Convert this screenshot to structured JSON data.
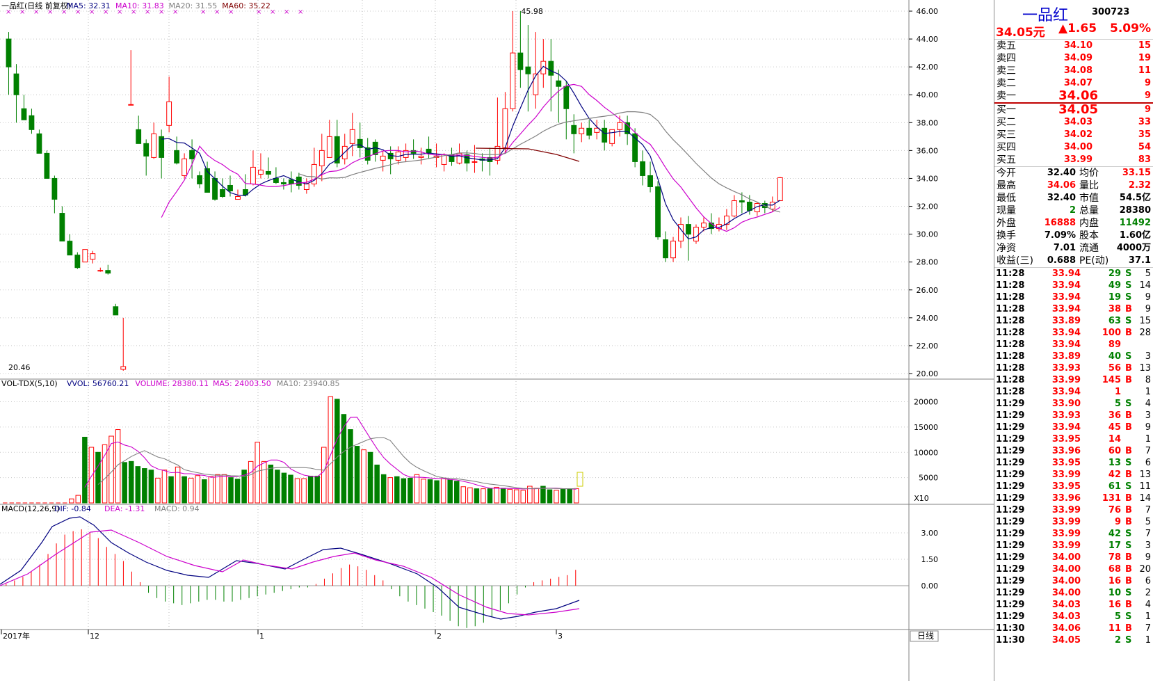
{
  "stock": {
    "name": "一品红",
    "code": "300723",
    "price": "34.05元",
    "change": "▲1.65",
    "change_pct": "5.09%"
  },
  "orderbook": {
    "asks": [
      {
        "label": "卖五",
        "price": "34.10",
        "vol": "15"
      },
      {
        "label": "卖四",
        "price": "34.09",
        "vol": "19"
      },
      {
        "label": "卖三",
        "price": "34.08",
        "vol": "11"
      },
      {
        "label": "卖二",
        "price": "34.07",
        "vol": "9"
      },
      {
        "label": "卖一",
        "price": "34.06",
        "vol": "9"
      }
    ],
    "bids": [
      {
        "label": "买一",
        "price": "34.05",
        "vol": "9"
      },
      {
        "label": "买二",
        "price": "34.03",
        "vol": "33"
      },
      {
        "label": "买三",
        "price": "34.02",
        "vol": "35"
      },
      {
        "label": "买四",
        "price": "34.00",
        "vol": "54"
      },
      {
        "label": "买五",
        "price": "33.99",
        "vol": "83"
      }
    ]
  },
  "stats": [
    {
      "k1": "今开",
      "v1": "32.40",
      "c1": "blk",
      "k2": "均价",
      "v2": "33.15",
      "c2": "red"
    },
    {
      "k1": "最高",
      "v1": "34.06",
      "c1": "red",
      "k2": "量比",
      "v2": "2.32",
      "c2": "red"
    },
    {
      "k1": "最低",
      "v1": "32.40",
      "c1": "blk",
      "k2": "市值",
      "v2": "54.5亿",
      "c2": "blk"
    },
    {
      "k1": "现量",
      "v1": "2",
      "c1": "grn",
      "k2": "总量",
      "v2": "28380",
      "c2": "blk"
    },
    {
      "k1": "外盘",
      "v1": "16888",
      "c1": "red",
      "k2": "内盘",
      "v2": "11492",
      "c2": "grn"
    },
    {
      "k1": "换手",
      "v1": "7.09%",
      "c1": "blk",
      "k2": "股本",
      "v2": "1.60亿",
      "c2": "blk"
    },
    {
      "k1": "净资",
      "v1": "7.01",
      "c1": "blk",
      "k2": "流通",
      "v2": "4000万",
      "c2": "blk"
    },
    {
      "k1": "收益(三)",
      "v1": "0.688",
      "c1": "blk",
      "k2": "PE(动)",
      "v2": "37.1",
      "c2": "blk"
    }
  ],
  "ticks": [
    [
      "11:28",
      "33.94",
      "29",
      "S",
      "5"
    ],
    [
      "11:28",
      "33.94",
      "49",
      "S",
      "14"
    ],
    [
      "11:28",
      "33.94",
      "19",
      "S",
      "9"
    ],
    [
      "11:28",
      "33.94",
      "38",
      "B",
      "9"
    ],
    [
      "11:28",
      "33.89",
      "63",
      "S",
      "15"
    ],
    [
      "11:28",
      "33.94",
      "100",
      "B",
      "28"
    ],
    [
      "11:28",
      "33.94",
      "89",
      "",
      ""
    ],
    [
      "11:28",
      "33.89",
      "40",
      "S",
      "3"
    ],
    [
      "11:28",
      "33.93",
      "56",
      "B",
      "13"
    ],
    [
      "11:28",
      "33.99",
      "145",
      "B",
      "8"
    ],
    [
      "11:28",
      "33.94",
      "1",
      "",
      "1"
    ],
    [
      "11:29",
      "33.90",
      "5",
      "S",
      "4"
    ],
    [
      "11:29",
      "33.93",
      "36",
      "B",
      "3"
    ],
    [
      "11:29",
      "33.94",
      "45",
      "B",
      "9"
    ],
    [
      "11:29",
      "33.95",
      "14",
      "",
      "1"
    ],
    [
      "11:29",
      "33.96",
      "60",
      "B",
      "7"
    ],
    [
      "11:29",
      "33.95",
      "13",
      "S",
      "6"
    ],
    [
      "11:29",
      "33.99",
      "42",
      "B",
      "13"
    ],
    [
      "11:29",
      "33.95",
      "61",
      "S",
      "11"
    ],
    [
      "11:29",
      "33.96",
      "131",
      "B",
      "14"
    ],
    [
      "11:29",
      "33.99",
      "76",
      "B",
      "7"
    ],
    [
      "11:29",
      "33.99",
      "9",
      "B",
      "5"
    ],
    [
      "11:29",
      "33.99",
      "42",
      "S",
      "7"
    ],
    [
      "11:29",
      "33.99",
      "17",
      "S",
      "3"
    ],
    [
      "11:29",
      "34.00",
      "78",
      "B",
      "9"
    ],
    [
      "11:29",
      "34.00",
      "68",
      "B",
      "20"
    ],
    [
      "11:29",
      "34.00",
      "16",
      "B",
      "6"
    ],
    [
      "11:29",
      "34.00",
      "10",
      "S",
      "2"
    ],
    [
      "11:29",
      "34.03",
      "16",
      "B",
      "4"
    ],
    [
      "11:29",
      "34.03",
      "5",
      "S",
      "1"
    ],
    [
      "11:30",
      "34.06",
      "11",
      "B",
      "7"
    ],
    [
      "11:30",
      "34.05",
      "2",
      "S",
      "1"
    ]
  ],
  "kline": {
    "title": "一品红(日线 前复权)",
    "ma_labels": [
      {
        "text": "MA5: 32.31",
        "color": "#000080"
      },
      {
        "text": "MA10: 31.83",
        "color": "#cc00cc"
      },
      {
        "text": "MA20: 31.55",
        "color": "#808080"
      },
      {
        "text": "MA60: 35.22",
        "color": "#800000"
      }
    ],
    "high_label": "45.98",
    "low_label": "20.46",
    "y_ticks": [
      "46.00",
      "44.00",
      "42.00",
      "40.00",
      "38.00",
      "36.00",
      "34.00",
      "32.00",
      "30.00",
      "28.00",
      "26.00",
      "24.00",
      "22.00",
      "20.00"
    ],
    "candles": [
      [
        44,
        44.5,
        42,
        40
      ],
      [
        41.5,
        42.2,
        40,
        38
      ],
      [
        39,
        40,
        38.2,
        38.5
      ],
      [
        38.5,
        39,
        37.5,
        37.2
      ],
      [
        37.2,
        37.5,
        35.8,
        36
      ],
      [
        35.8,
        36,
        34,
        34
      ],
      [
        34,
        34.2,
        32.5,
        31.5
      ],
      [
        31.5,
        32,
        29.5,
        29.5
      ],
      [
        29.5,
        30,
        28.5,
        28.5
      ],
      [
        28.5,
        28.7,
        27.6,
        27.5
      ],
      [
        28,
        28.4,
        28.9,
        28
      ],
      [
        28.2,
        28.8,
        28.6,
        27.9
      ],
      [
        27.4,
        27.6,
        27.4,
        27.3
      ],
      [
        27.4,
        27.8,
        27.2,
        27.1
      ],
      [
        24.8,
        25,
        24.2,
        24.2
      ],
      [
        20.3,
        24,
        20.5,
        20.2
      ],
      [
        39.3,
        43.2,
        39.3,
        39.3
      ],
      [
        37.5,
        38.5,
        36.5,
        36.5
      ],
      [
        36.5,
        36.8,
        35.6,
        34.2
      ],
      [
        35.5,
        38,
        37.2,
        35.4
      ],
      [
        37,
        37.5,
        35.5,
        34
      ],
      [
        37.8,
        41.3,
        39.5,
        37.3
      ],
      [
        36,
        37,
        35.1,
        35
      ],
      [
        34.2,
        35.8,
        35.4,
        34
      ],
      [
        36,
        36.8,
        35.4,
        34
      ],
      [
        34.2,
        34.5,
        33.6,
        33.3
      ],
      [
        34.7,
        35.2,
        33,
        33
      ],
      [
        34,
        34.5,
        32.5,
        32.4
      ],
      [
        33.2,
        34,
        32.7,
        32.6
      ],
      [
        33.5,
        34.2,
        33.1,
        32.7
      ],
      [
        32.5,
        33.2,
        32.7,
        32.5
      ],
      [
        33.2,
        34.3,
        32.8,
        32.7
      ],
      [
        33.6,
        36,
        34.8,
        33.5
      ],
      [
        34.3,
        35.8,
        34.6,
        34
      ],
      [
        34.5,
        35.5,
        34.3,
        34
      ],
      [
        34,
        34.8,
        33.7,
        33.6
      ],
      [
        33.7,
        34,
        33.6,
        33.2
      ],
      [
        33.9,
        34.5,
        33.6,
        33
      ],
      [
        34.1,
        34.4,
        33.5,
        33.2
      ],
      [
        33.2,
        34,
        33.6,
        32.9
      ],
      [
        33.6,
        36.2,
        35,
        33.4
      ],
      [
        34.9,
        37.2,
        36,
        33.8
      ],
      [
        35.5,
        38.2,
        37,
        35.5
      ],
      [
        37,
        38.2,
        35.1,
        34.8
      ],
      [
        35.4,
        37.2,
        36.3,
        35
      ],
      [
        36.5,
        38.7,
        37.5,
        35.6
      ],
      [
        36.8,
        38,
        36.2,
        35.5
      ],
      [
        36.2,
        36.9,
        35.3,
        35
      ],
      [
        36.6,
        36.8,
        35.7,
        35.2
      ],
      [
        35.3,
        36,
        35.6,
        34.5
      ],
      [
        35.8,
        36.3,
        35.4,
        34.3
      ],
      [
        35.3,
        36.3,
        35.9,
        35
      ],
      [
        35.5,
        36.5,
        36,
        35.2
      ],
      [
        36,
        36.8,
        35.8,
        35.4
      ],
      [
        35.5,
        36.2,
        35.6,
        35
      ],
      [
        36.1,
        37,
        35.8,
        35.4
      ],
      [
        35.5,
        36.5,
        35.6,
        34.8
      ],
      [
        35,
        35.8,
        35.7,
        34.5
      ],
      [
        35.7,
        36.2,
        35.2,
        34.9
      ],
      [
        35.1,
        36.5,
        35.8,
        35
      ],
      [
        35.7,
        36,
        35.1,
        34.5
      ],
      [
        35.2,
        36.4,
        35.2,
        34.4
      ],
      [
        35.4,
        35.8,
        35.3,
        34.5
      ],
      [
        35.5,
        36.2,
        35.2,
        34.2
      ],
      [
        35.3,
        39.8,
        36.3,
        35
      ],
      [
        36.2,
        40.2,
        39,
        35.8
      ],
      [
        39,
        46,
        43,
        38.8
      ],
      [
        43,
        46,
        41.8,
        40.5
      ],
      [
        42,
        45,
        41.5,
        38.8
      ],
      [
        40,
        44.5,
        41.5,
        39
      ],
      [
        41.5,
        44,
        42.4,
        40.5
      ],
      [
        42.4,
        44,
        41.4,
        38.8
      ],
      [
        41,
        41.8,
        40.6,
        38
      ],
      [
        40.6,
        41,
        39,
        36.8
      ],
      [
        37.8,
        38.6,
        37.2,
        35.8
      ],
      [
        37.2,
        38,
        37.6,
        36.6
      ],
      [
        37.6,
        38.2,
        37.1,
        36.8
      ],
      [
        37.3,
        38.2,
        37.6,
        36.8
      ],
      [
        37.6,
        38.2,
        36.6,
        36
      ],
      [
        36.5,
        37.5,
        37.5,
        36.3
      ],
      [
        37.5,
        38.5,
        38,
        37
      ],
      [
        38,
        38.5,
        37.2,
        36.4
      ],
      [
        37.2,
        37.6,
        35.2,
        34.8
      ],
      [
        35.2,
        36,
        34.2,
        33.5
      ],
      [
        34.2,
        35.2,
        33.4,
        33
      ],
      [
        33.4,
        33.8,
        29.8,
        29.6
      ],
      [
        29.6,
        30.2,
        28.3,
        28
      ],
      [
        28.3,
        29.8,
        29.5,
        28
      ],
      [
        29.5,
        31.2,
        30.7,
        29
      ],
      [
        30.7,
        31.3,
        30,
        28.1
      ],
      [
        29.5,
        30.7,
        30.5,
        29.3
      ],
      [
        30.5,
        31.2,
        30.8,
        30.2
      ],
      [
        30.8,
        31.5,
        30.4,
        30
      ],
      [
        30.4,
        31.2,
        30.7,
        30.2
      ],
      [
        30.7,
        31.8,
        31.3,
        30.3
      ],
      [
        31.3,
        32.8,
        32.4,
        31.2
      ],
      [
        32.4,
        33,
        32.3,
        31.5
      ],
      [
        32.3,
        32.8,
        31.7,
        31.4
      ],
      [
        31.6,
        32.3,
        32.2,
        31.3
      ],
      [
        32.2,
        32.4,
        31.9,
        31.5
      ],
      [
        31.8,
        32.7,
        32.3,
        31.6
      ],
      [
        32.4,
        34.1,
        34.05,
        32.4
      ]
    ],
    "marks": [
      "×",
      "×",
      "×",
      "×",
      "×",
      "×",
      "×",
      "×",
      "×",
      "×",
      "×",
      "×",
      "×",
      "×",
      "×",
      "×",
      "×",
      "×",
      "×",
      "×"
    ]
  },
  "volume": {
    "title": "VOL-TDX(5,10)",
    "labels": [
      {
        "text": "VVOL: 56760.21",
        "color": "#000080"
      },
      {
        "text": "VOLUME: 28380.11",
        "color": "#cc00cc"
      },
      {
        "text": "MA5: 24003.50",
        "color": "#cc00cc"
      },
      {
        "text": "MA10: 23940.85",
        "color": "#808080"
      }
    ],
    "y_ticks": [
      "20000",
      "15000",
      "10000",
      "5000"
    ],
    "unit": "X10",
    "bars": [
      0,
      0,
      0,
      0,
      0,
      0,
      0,
      0,
      0,
      0,
      800,
      1500,
      13000,
      11000,
      10000,
      11500,
      13200,
      14500,
      8000,
      8200,
      7200,
      6800,
      6500,
      4900,
      6500,
      5200,
      7100,
      5200,
      4900,
      5400,
      4600,
      5200,
      5600,
      5600,
      5000,
      4700,
      6500,
      8200,
      12000,
      8200,
      7500,
      6500,
      5900,
      5500,
      4800,
      4800,
      5300,
      5300,
      11000,
      21000,
      20500,
      17500,
      14500,
      11200,
      10500,
      10000,
      7500,
      5600,
      5000,
      5200,
      4800,
      4900,
      5600,
      4700,
      4600,
      4400,
      4800,
      4600,
      4300,
      3200,
      3000,
      2800,
      2800,
      2800,
      3100,
      2900,
      2700,
      2600,
      2500,
      3300,
      2900,
      3300,
      2600,
      2500,
      2800,
      2800,
      2838
    ],
    "bar_up": [
      1,
      1,
      1,
      1,
      1,
      1,
      1,
      1,
      1,
      1,
      1,
      1,
      0,
      1,
      0,
      1,
      1,
      1,
      0,
      0,
      0,
      0,
      0,
      1,
      1,
      0,
      1,
      0,
      1,
      1,
      0,
      1,
      1,
      1,
      0,
      0,
      0,
      1,
      1,
      1,
      0,
      0,
      0,
      0,
      1,
      1,
      0,
      0,
      1,
      1,
      0,
      0,
      0,
      0,
      1,
      0,
      0,
      0,
      1,
      0,
      0,
      0,
      1,
      1,
      0,
      0,
      1,
      0,
      0,
      1,
      1,
      0,
      1,
      0,
      1,
      0,
      1,
      1,
      1,
      1,
      1,
      0,
      0,
      1,
      0,
      0,
      1
    ]
  },
  "macd": {
    "title": "MACD(12,26,9)",
    "labels": [
      {
        "text": "DIF: -0.84",
        "color": "#000080"
      },
      {
        "text": "DEA: -1.31",
        "color": "#cc00cc"
      },
      {
        "text": "MACD: 0.94",
        "color": "#808080"
      }
    ],
    "y_ticks": [
      "3.00",
      "1.50",
      "0.00"
    ]
  },
  "x_axis": {
    "labels": [
      "2017年",
      "12",
      "1",
      "2",
      "3"
    ],
    "period": "日线"
  }
}
